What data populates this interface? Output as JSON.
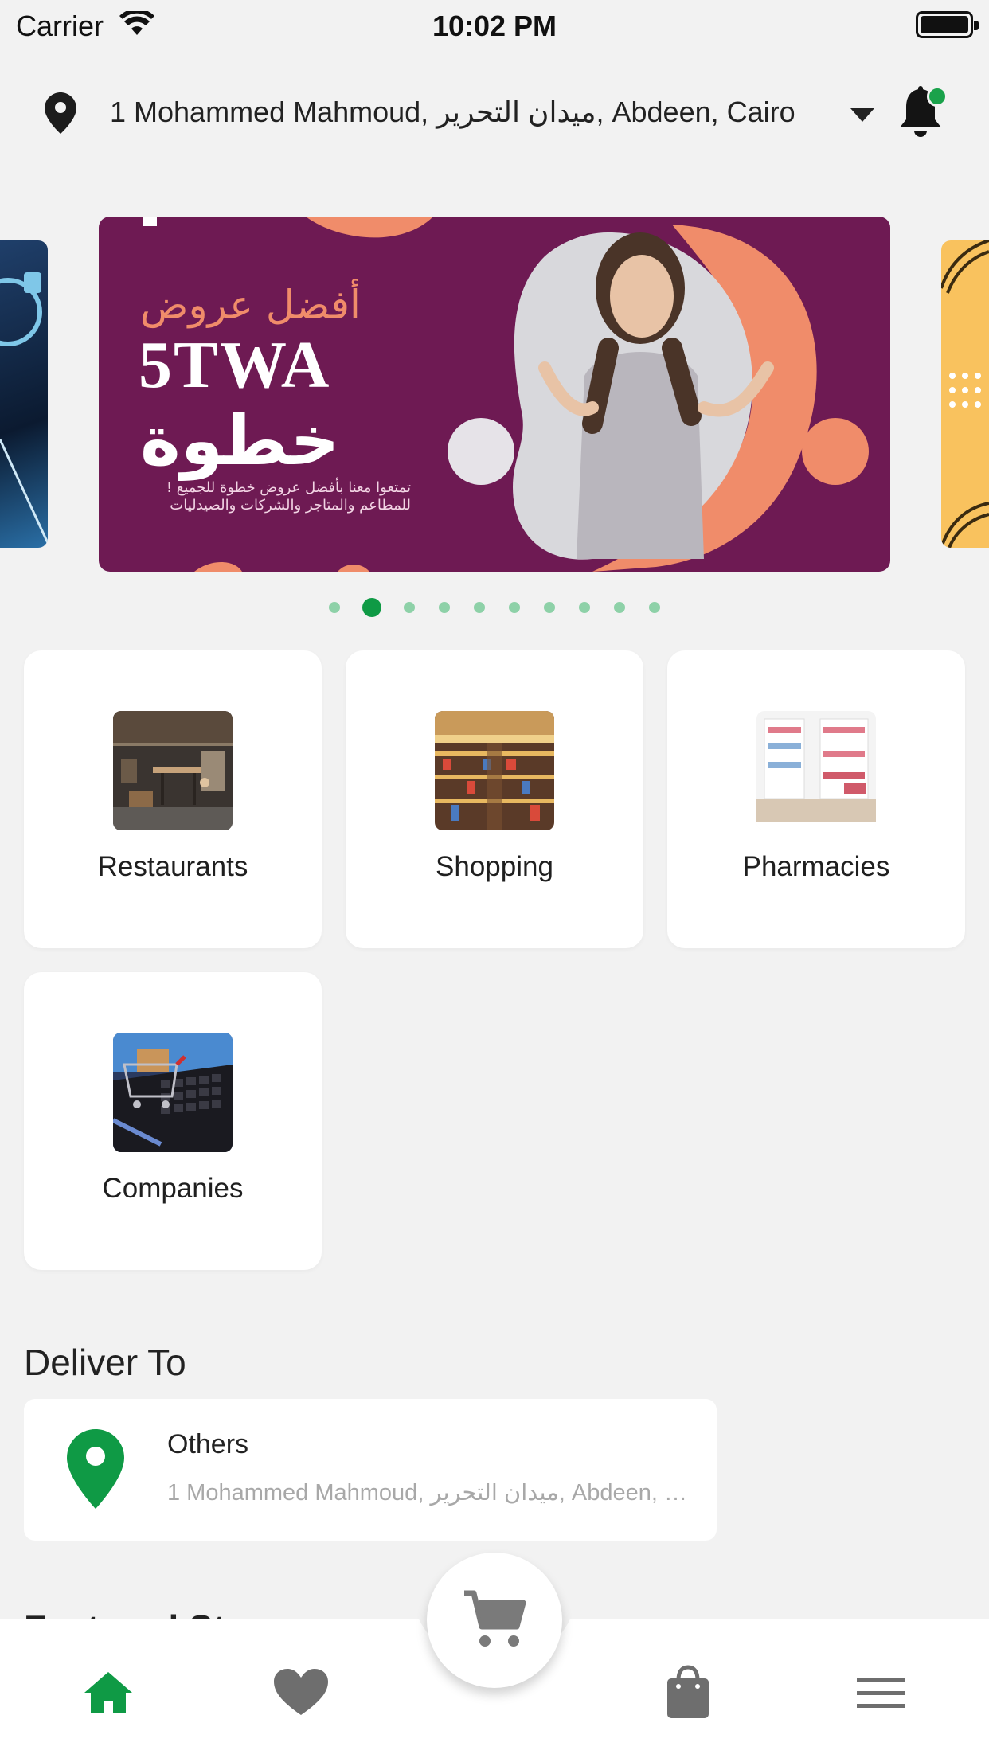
{
  "status_bar": {
    "carrier": "Carrier",
    "time": "10:02 PM"
  },
  "header": {
    "address": "1 Mohammed Mahmoud, ميدان التحرير, Abdeen, Cairo …",
    "notification_badge": "green-dot"
  },
  "carousel": {
    "banner": {
      "arabic_title": "أفضل عروض",
      "brand": "5TWA",
      "arabic_brand": "خطوة",
      "subtitle_line1": "تمتعوا معنا بأفضل عروض خطوة للجميع !",
      "subtitle_line2": "للمطاعم والمتاجر والشركات والصيدليات"
    },
    "page_count": 10,
    "active_page": 2
  },
  "categories": [
    {
      "label": "Restaurants",
      "icon": "restaurant-photo"
    },
    {
      "label": "Shopping",
      "icon": "mall-photo"
    },
    {
      "label": "Pharmacies",
      "icon": "pharmacy-photo"
    },
    {
      "label": "Companies",
      "icon": "laptop-cart-photo"
    }
  ],
  "deliver_to": {
    "title": "Deliver To",
    "name": "Others",
    "address": "1 Mohammed Mahmoud, ميدان التحرير, Abdeen, …"
  },
  "featured_peek": "Featured St",
  "bottom_nav": {
    "items": [
      "home-icon",
      "heart-icon",
      "cart-icon",
      "bag-icon",
      "menu-icon"
    ],
    "active": "home-icon"
  },
  "colors": {
    "accent": "#0f9a45",
    "banner_bg": "#6e1a53",
    "banner_accent": "#f08c6a",
    "page_bg": "#f2f2f2"
  }
}
